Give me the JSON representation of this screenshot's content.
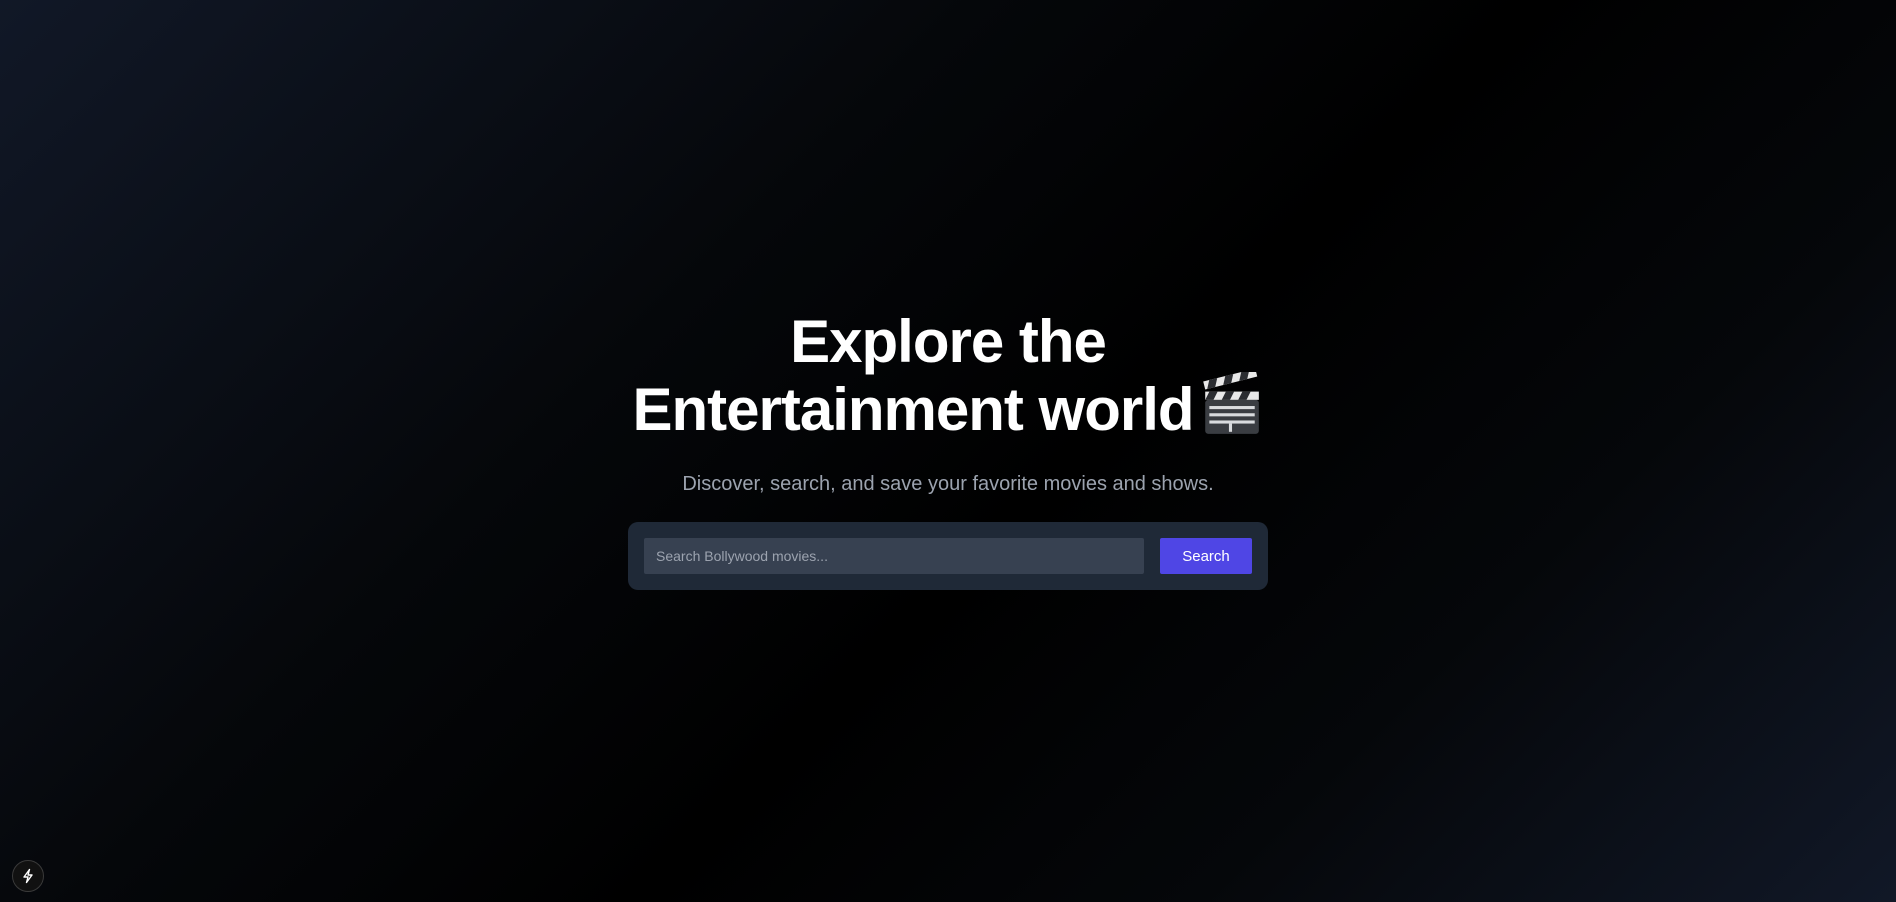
{
  "hero": {
    "title_line1": "Explore the",
    "title_line2": "Entertainment world",
    "title_emoji_icon": "clapper-board-icon",
    "subtitle": "Discover, search, and save your favorite movies and shows."
  },
  "search": {
    "placeholder": "Search Bollywood movies...",
    "value": "",
    "button_label": "Search"
  },
  "dev_badge": {
    "icon": "lightning-bolt-icon"
  },
  "colors": {
    "accent": "#4f46e5",
    "panel": "#1f2937",
    "input": "#374151",
    "subtitle": "#9ca3af"
  }
}
